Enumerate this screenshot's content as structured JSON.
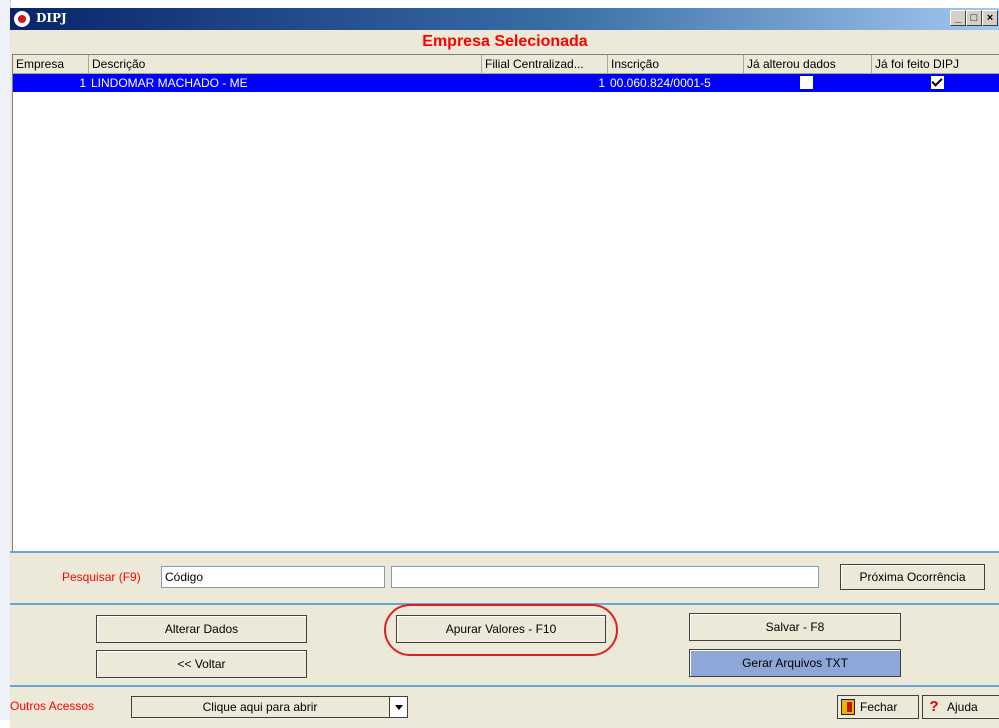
{
  "window": {
    "title": "DIPJ",
    "minimize": "_",
    "maximize": "□",
    "close": "×"
  },
  "heading": "Empresa Selecionada",
  "table": {
    "columns": [
      "Empresa",
      "Descrição",
      "Filial Centralizad...",
      "Inscrição",
      "Já alterou dados",
      "Já foi feito DIPJ"
    ],
    "rows": [
      {
        "empresa": "1",
        "descricao": "LINDOMAR MACHADO - ME",
        "filial": "1",
        "inscricao": "00.060.824/0001-5",
        "ja_alterou": false,
        "ja_feito": true
      }
    ]
  },
  "search": {
    "label": "Pesquisar (F9)",
    "field_value": "Código",
    "query_value": "",
    "next_button": "Próxima Ocorrência"
  },
  "buttons": {
    "alterar_dados": "Alterar Dados",
    "voltar": "<< Voltar",
    "apurar_valores": "Apurar Valores  - F10",
    "salvar": "Salvar - F8",
    "gerar_arquivos": "Gerar Arquivos TXT"
  },
  "footer": {
    "outros_acessos": "Outros Acessos",
    "combo_value": "Clique aqui para abrir",
    "fechar": "Fechar",
    "ajuda": "Ajuda"
  },
  "colors": {
    "accent_red": "#ff0000",
    "selection_blue": "#0000ff",
    "titlebar": "#0a246a",
    "highlight_oval": "#e02020"
  },
  "icons": {
    "app": "record-icon",
    "fechar": "door-exit-icon",
    "ajuda": "question-icon",
    "combo": "dropdown-arrow-icon"
  }
}
